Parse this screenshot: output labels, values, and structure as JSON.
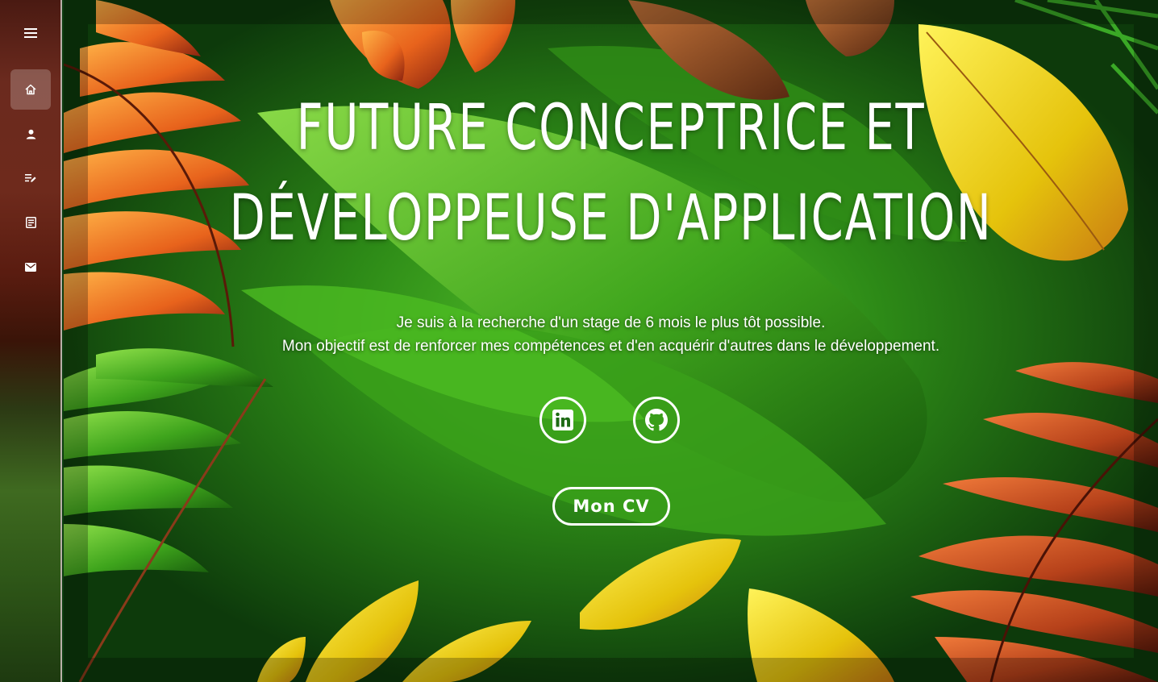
{
  "sidebar": {
    "items": [
      {
        "icon": "menu-icon",
        "label": ""
      },
      {
        "icon": "home-icon",
        "label": "",
        "active": true
      },
      {
        "icon": "person-icon",
        "label": ""
      },
      {
        "icon": "list-edit-icon",
        "label": ""
      },
      {
        "icon": "contact-card-icon",
        "label": ""
      },
      {
        "icon": "mail-icon",
        "label": ""
      }
    ]
  },
  "hero": {
    "title_line1": "FUTURE CONCEPTRICE ET",
    "title_line2": "DÉVELOPPEUSE D'APPLICATION",
    "description_line1": "Je suis à la recherche d'un stage de 6 mois le plus tôt possible.",
    "description_line2": "Mon objectif est de renforcer mes compétences et d'en acquérir d'autres dans le développement.",
    "social": [
      {
        "icon": "linkedin-icon"
      },
      {
        "icon": "github-icon"
      }
    ],
    "cv_button": "Mon CV"
  },
  "colors": {
    "text": "#ffffff",
    "background_green": "#1e6a14",
    "sidebar_brown": "#6b2a1e"
  }
}
